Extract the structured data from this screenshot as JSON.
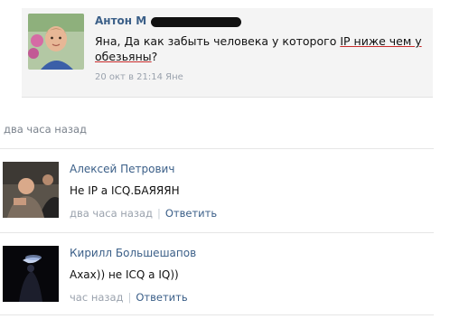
{
  "quote": {
    "author": "Антон М",
    "text_before": "Яна, Да как забыть человека у которого ",
    "text_highlight": "IP ниже чем у обезьяны",
    "text_after": "?",
    "meta": "20 окт в 21:14 Яне"
  },
  "since_label": "два часа назад",
  "comments": [
    {
      "author": "Алексей Петрович",
      "text": "Не IP а ICQ.БАЯЯЯН",
      "time": "два часа назад",
      "separator": "|",
      "reply": "Ответить"
    },
    {
      "author": "Кирилл Большешапов",
      "text": "Axax)) не ICQ а IQ))",
      "time": "час назад",
      "separator": "|",
      "reply": "Ответить"
    }
  ],
  "colors": {
    "link": "#3b5f88",
    "meta": "#9aa2ad",
    "quote_bg": "#f4f4f4",
    "highlight_underline": "#c92b2b"
  }
}
